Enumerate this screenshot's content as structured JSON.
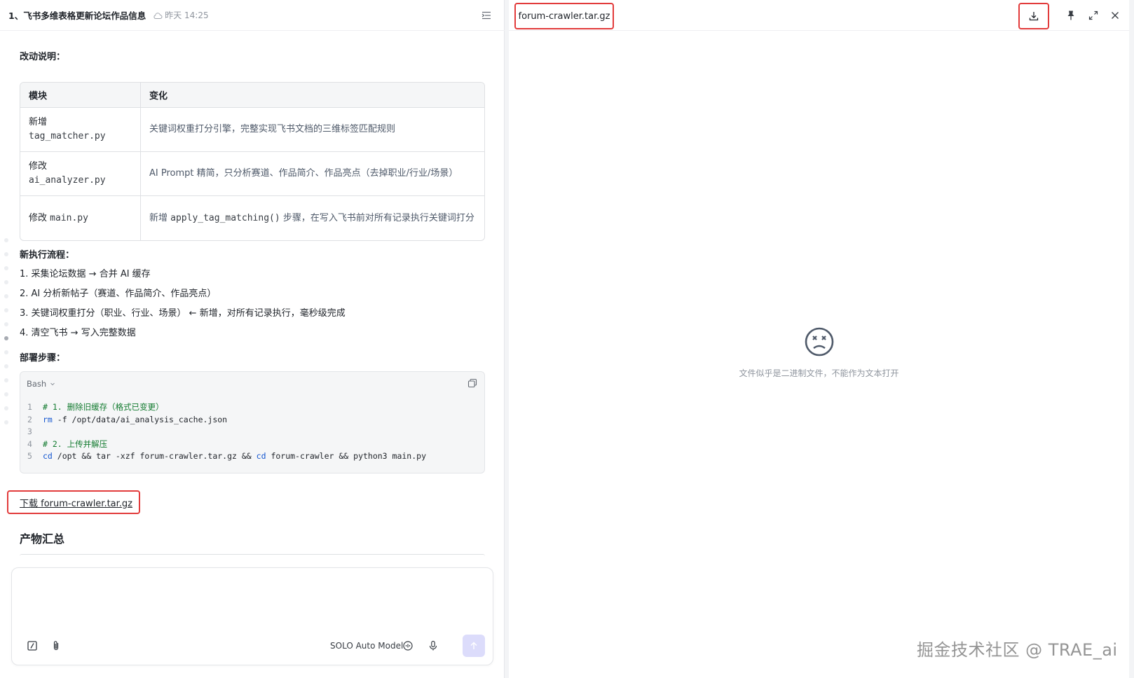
{
  "left_header": {
    "title": "1、飞书多维表格更新论坛作品信息",
    "time": "昨天 14:25"
  },
  "changes": {
    "heading": "改动说明：",
    "columns": [
      "模块",
      "变化"
    ],
    "rows": [
      {
        "action": "新增",
        "file": "tag_matcher.py",
        "desc": "关键词权重打分引擎，完整实现飞书文档的三维标签匹配规则"
      },
      {
        "action": "修改",
        "file": "ai_analyzer.py",
        "desc": "AI Prompt 精简，只分析赛道、作品简介、作品亮点（去掉职业/行业/场景）"
      },
      {
        "action": "修改",
        "file": "main.py",
        "desc_prefix": "新增 ",
        "desc_code": "apply_tag_matching()",
        "desc_suffix": " 步骤，在写入飞书前对所有记录执行关键词打分"
      }
    ]
  },
  "flow": {
    "heading": "新执行流程：",
    "steps": [
      "1. 采集论坛数据 → 合并 AI 缓存",
      "2. AI 分析新帖子（赛道、作品简介、作品亮点）",
      "3. 关键词权重打分（职业、行业、场景） ← 新增，对所有记录执行，毫秒级完成",
      "4. 清空飞书 → 写入完整数据"
    ]
  },
  "deploy": {
    "heading": "部署步骤：",
    "lang": "Bash",
    "line_numbers": [
      "1",
      "2",
      "3",
      "4",
      "5"
    ],
    "code": {
      "l1": "# 1. 删除旧缓存（格式已变更）",
      "l2_kw": "rm",
      "l2_rest": " -f /opt/data/ai_analysis_cache.json",
      "l4": "# 2. 上传并解压",
      "l5_kw1": "cd",
      "l5_mid": " /opt && tar -xzf forum-crawler.tar.gz && ",
      "l5_kw2": "cd",
      "l5_rest": " forum-crawler && python3 main.py"
    }
  },
  "download_link": "下载 forum-crawler.tar.gz",
  "summary_heading": "产物汇总",
  "chat": {
    "model": "SOLO Auto Model"
  },
  "right_panel": {
    "file_name": "forum-crawler.tar.gz",
    "empty_message": "文件似乎是二进制文件，不能作为文本打开"
  },
  "watermark": "掘金技术社区 @ TRAE_ai",
  "colors": {
    "highlight_border": "#e23b3b",
    "send_button": "#dcdcfb",
    "comment": "#117a2e",
    "keyword": "#1456d0"
  }
}
